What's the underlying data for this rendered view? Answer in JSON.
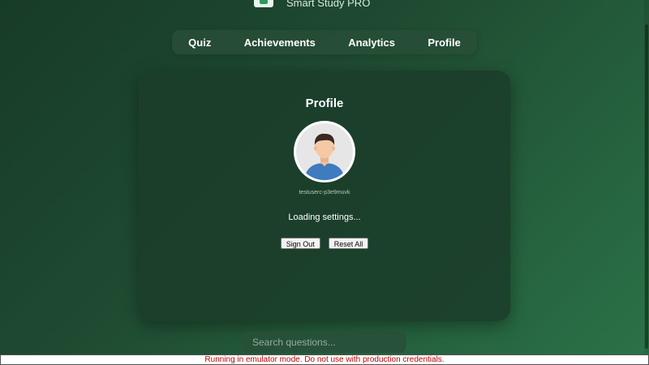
{
  "app": {
    "title": "Smart Study PRO"
  },
  "nav": {
    "items": [
      {
        "label": "Quiz"
      },
      {
        "label": "Achievements"
      },
      {
        "label": "Analytics"
      },
      {
        "label": "Profile"
      }
    ]
  },
  "profile": {
    "title": "Profile",
    "avatar_icon": "user-avatar-icon",
    "username": "testuserc-p3e9muvk",
    "status": "Loading settings...",
    "sign_out_label": "Sign Out",
    "reset_label": "Reset All"
  },
  "search": {
    "placeholder": "Search questions..."
  },
  "banner": {
    "text": "Running in emulator mode. Do not use with production credentials."
  },
  "colors": {
    "accent": "#2e9a5a",
    "banner_text": "#c00000"
  }
}
